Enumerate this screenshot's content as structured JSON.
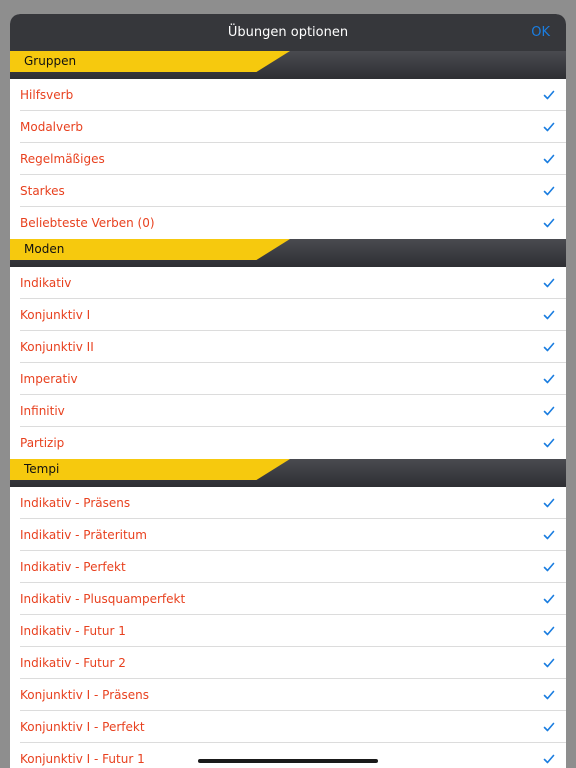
{
  "nav": {
    "title": "Übungen optionen",
    "ok_label": "OK"
  },
  "colors": {
    "accent": "#1a7de0",
    "item_text": "#e8411f",
    "section_tab": "#f6c90e",
    "header_bg": "#36373b"
  },
  "sections": [
    {
      "label": "Gruppen",
      "items": [
        {
          "label": "Hilfsverb",
          "checked": true
        },
        {
          "label": "Modalverb",
          "checked": true
        },
        {
          "label": "Regelmäßiges",
          "checked": true
        },
        {
          "label": "Starkes",
          "checked": true
        },
        {
          "label": "Beliebteste Verben (0)",
          "checked": true
        }
      ]
    },
    {
      "label": "Moden",
      "items": [
        {
          "label": "Indikativ",
          "checked": true
        },
        {
          "label": "Konjunktiv I",
          "checked": true
        },
        {
          "label": "Konjunktiv II",
          "checked": true
        },
        {
          "label": "Imperativ",
          "checked": true
        },
        {
          "label": "Infinitiv",
          "checked": true
        },
        {
          "label": "Partizip",
          "checked": true
        }
      ]
    },
    {
      "label": "Tempi",
      "items": [
        {
          "label": "Indikativ - Präsens",
          "checked": true
        },
        {
          "label": "Indikativ - Präteritum",
          "checked": true
        },
        {
          "label": "Indikativ - Perfekt",
          "checked": true
        },
        {
          "label": "Indikativ - Plusquamperfekt",
          "checked": true
        },
        {
          "label": "Indikativ - Futur 1",
          "checked": true
        },
        {
          "label": "Indikativ - Futur 2",
          "checked": true
        },
        {
          "label": "Konjunktiv I - Präsens",
          "checked": true
        },
        {
          "label": "Konjunktiv I - Perfekt",
          "checked": true
        },
        {
          "label": "Konjunktiv I - Futur 1",
          "checked": true
        }
      ]
    }
  ]
}
